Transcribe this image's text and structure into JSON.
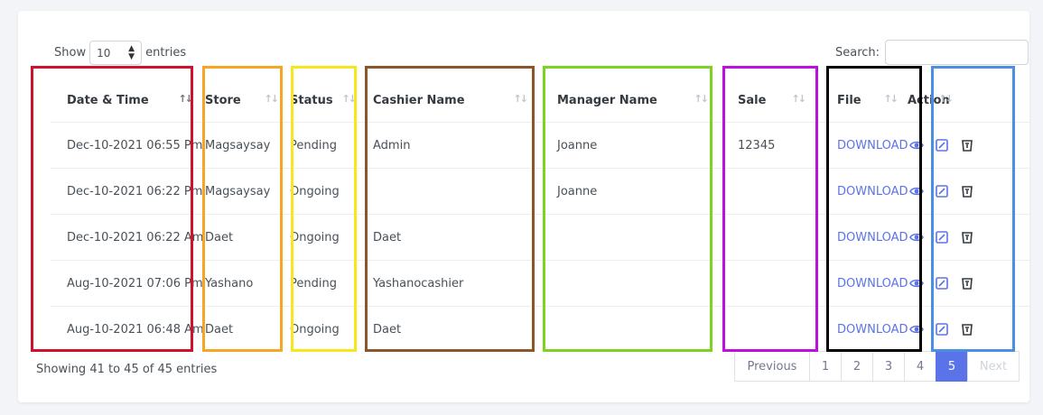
{
  "controls": {
    "show_label": "Show",
    "entries_value": "10",
    "entries_label": "entries",
    "search_label": "Search:",
    "search_value": ""
  },
  "columns": [
    "Date & Time",
    "Store",
    "Status",
    "Cashier Name",
    "Manager Name",
    "Sale",
    "File",
    "Action"
  ],
  "rows": [
    {
      "datetime": "Dec-10-2021 06:55 Pm",
      "store": "Magsaysay",
      "status": "Pending",
      "cashier": "Admin",
      "manager": "Joanne",
      "sale": "12345",
      "file": "DOWNLOAD"
    },
    {
      "datetime": "Dec-10-2021 06:22 Pm",
      "store": "Magsaysay",
      "status": "Ongoing",
      "cashier": "",
      "manager": "Joanne",
      "sale": "",
      "file": "DOWNLOAD"
    },
    {
      "datetime": "Dec-10-2021 06:22 Am",
      "store": "Daet",
      "status": "Ongoing",
      "cashier": "Daet",
      "manager": "",
      "sale": "",
      "file": "DOWNLOAD"
    },
    {
      "datetime": "Aug-10-2021 07:06 Pm",
      "store": "Yashano",
      "status": "Pending",
      "cashier": "Yashanocashier",
      "manager": "",
      "sale": "",
      "file": "DOWNLOAD"
    },
    {
      "datetime": "Aug-10-2021 06:48 Am",
      "store": "Daet",
      "status": "Ongoing",
      "cashier": "Daet",
      "manager": "",
      "sale": "",
      "file": "DOWNLOAD"
    }
  ],
  "footer": {
    "info": "Showing 41 to 45 of 45 entries"
  },
  "pagination": {
    "previous": "Previous",
    "pages": [
      "1",
      "2",
      "3",
      "4",
      "5"
    ],
    "next": "Next",
    "active_page": "5"
  },
  "colors": {
    "accent": "#5b73e8",
    "action_icon": "#5b73e8",
    "delete_icon": "#343a40"
  },
  "highlight_colors": [
    "#d0112b",
    "#f5a623",
    "#f8e71c",
    "#8b572a",
    "#7ed321",
    "#bd10e0",
    "#000000",
    "#4a90e2"
  ]
}
